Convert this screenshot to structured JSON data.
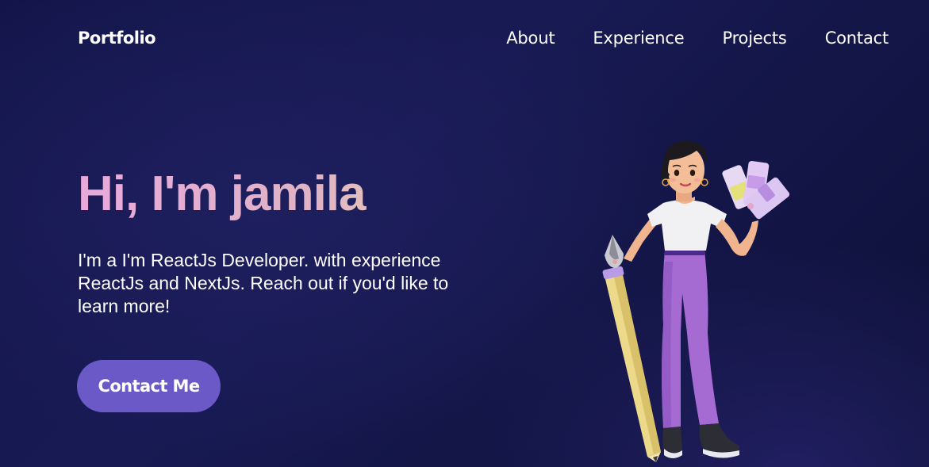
{
  "navbar": {
    "logo": "Portfolio",
    "links": [
      {
        "label": "About"
      },
      {
        "label": "Experience"
      },
      {
        "label": "Projects"
      },
      {
        "label": "Contact"
      }
    ]
  },
  "hero": {
    "title": "Hi, I'm jamila",
    "description": "I'm a I'm ReactJs Developer. with experience ReactJs and NextJs. Reach out if you'd like to learn more!",
    "cta_label": "Contact Me",
    "illustration": "3d-avatar-designer-with-pencil-and-color-swatches"
  },
  "colors": {
    "background": "#161850",
    "accent": "#6a59c7",
    "title_gradient_start": "#e8a9dc",
    "title_gradient_end": "#efdcaa",
    "text": "#ffffff"
  }
}
